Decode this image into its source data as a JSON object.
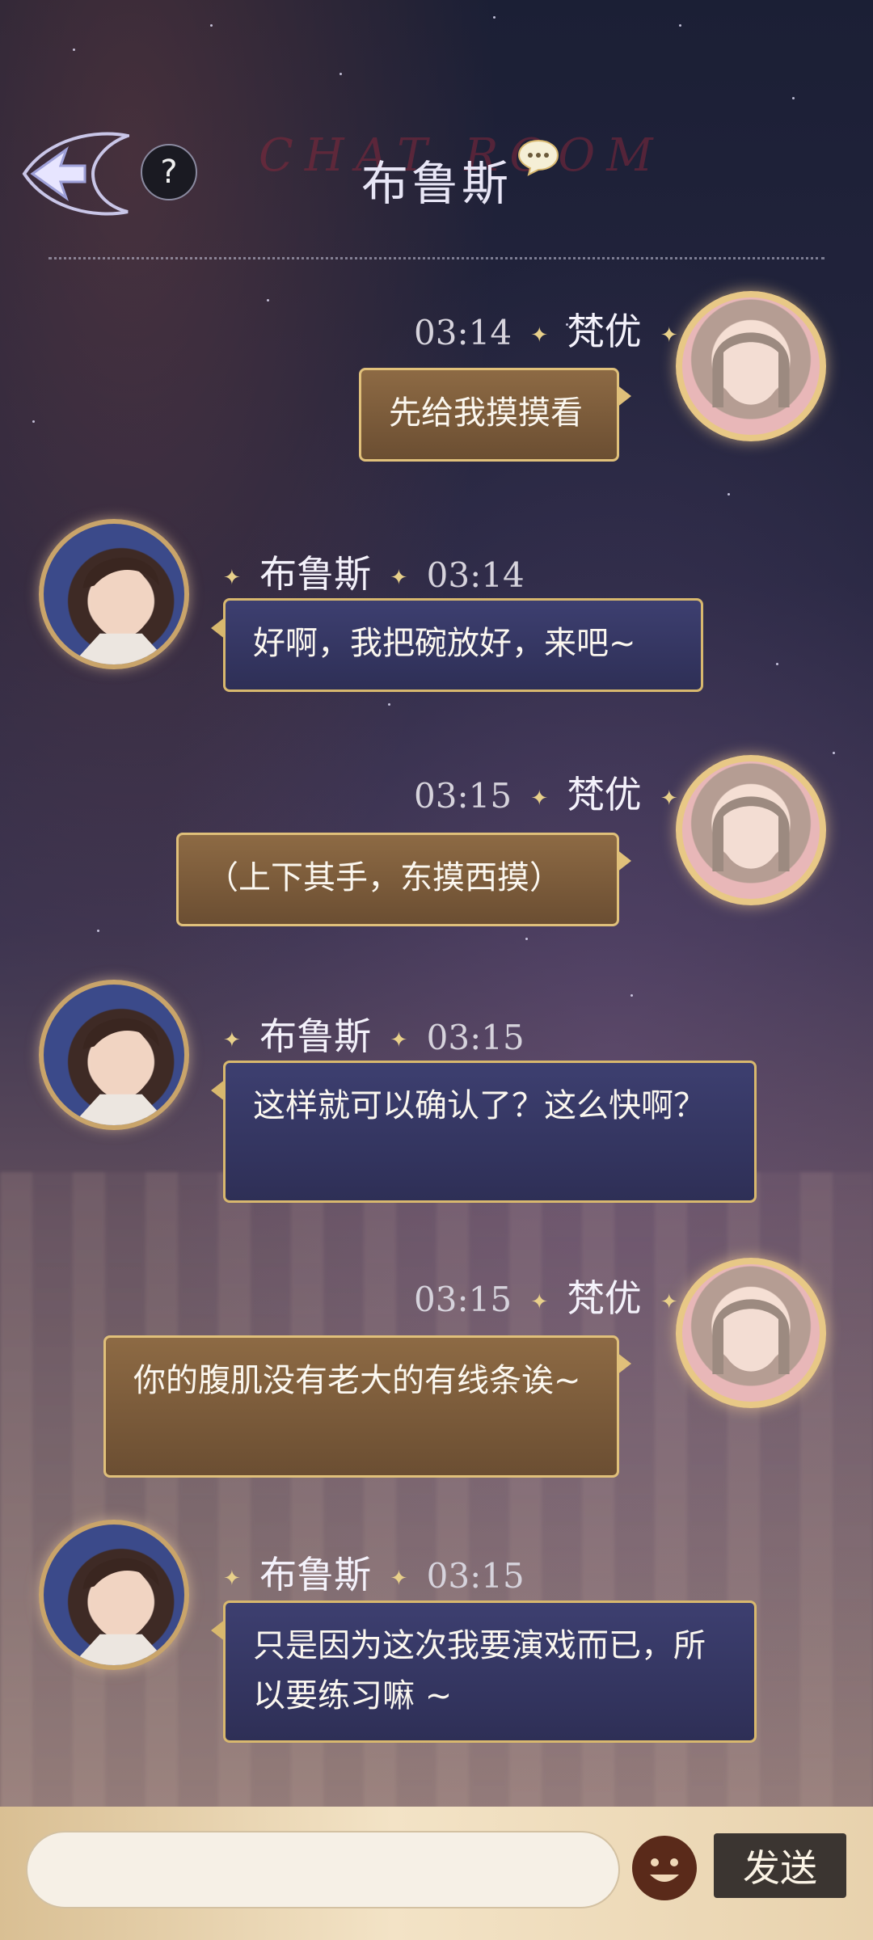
{
  "header": {
    "title": "布鲁斯",
    "watermark": "CHAT ROOM",
    "help_label": "?"
  },
  "messages": [
    {
      "sender": "梵优",
      "time": "03:14",
      "text": "先给我摸摸看",
      "side": "right"
    },
    {
      "sender": "布鲁斯",
      "time": "03:14",
      "text": "好啊，我把碗放好，来吧~",
      "side": "left"
    },
    {
      "sender": "梵优",
      "time": "03:15",
      "text": "（上下其手，东摸西摸）",
      "side": "right"
    },
    {
      "sender": "布鲁斯",
      "time": "03:15",
      "text": "这样就可以确认了？这么快啊？",
      "side": "left"
    },
    {
      "sender": "梵优",
      "time": "03:15",
      "text": "你的腹肌没有老大的有线条诶~",
      "side": "right"
    },
    {
      "sender": "布鲁斯",
      "time": "03:15",
      "text": "只是因为这次我要演戏而已，所以要练习嘛 ~",
      "side": "left"
    }
  ],
  "input": {
    "value": "",
    "emoji_icon": "emoji-face-icon",
    "send_label": "发送"
  },
  "colors": {
    "her_bubble": "#7a5a3b",
    "him_bubble": "#34365f",
    "gold_border": "#e0c07a",
    "send_button": "#3b3531"
  }
}
